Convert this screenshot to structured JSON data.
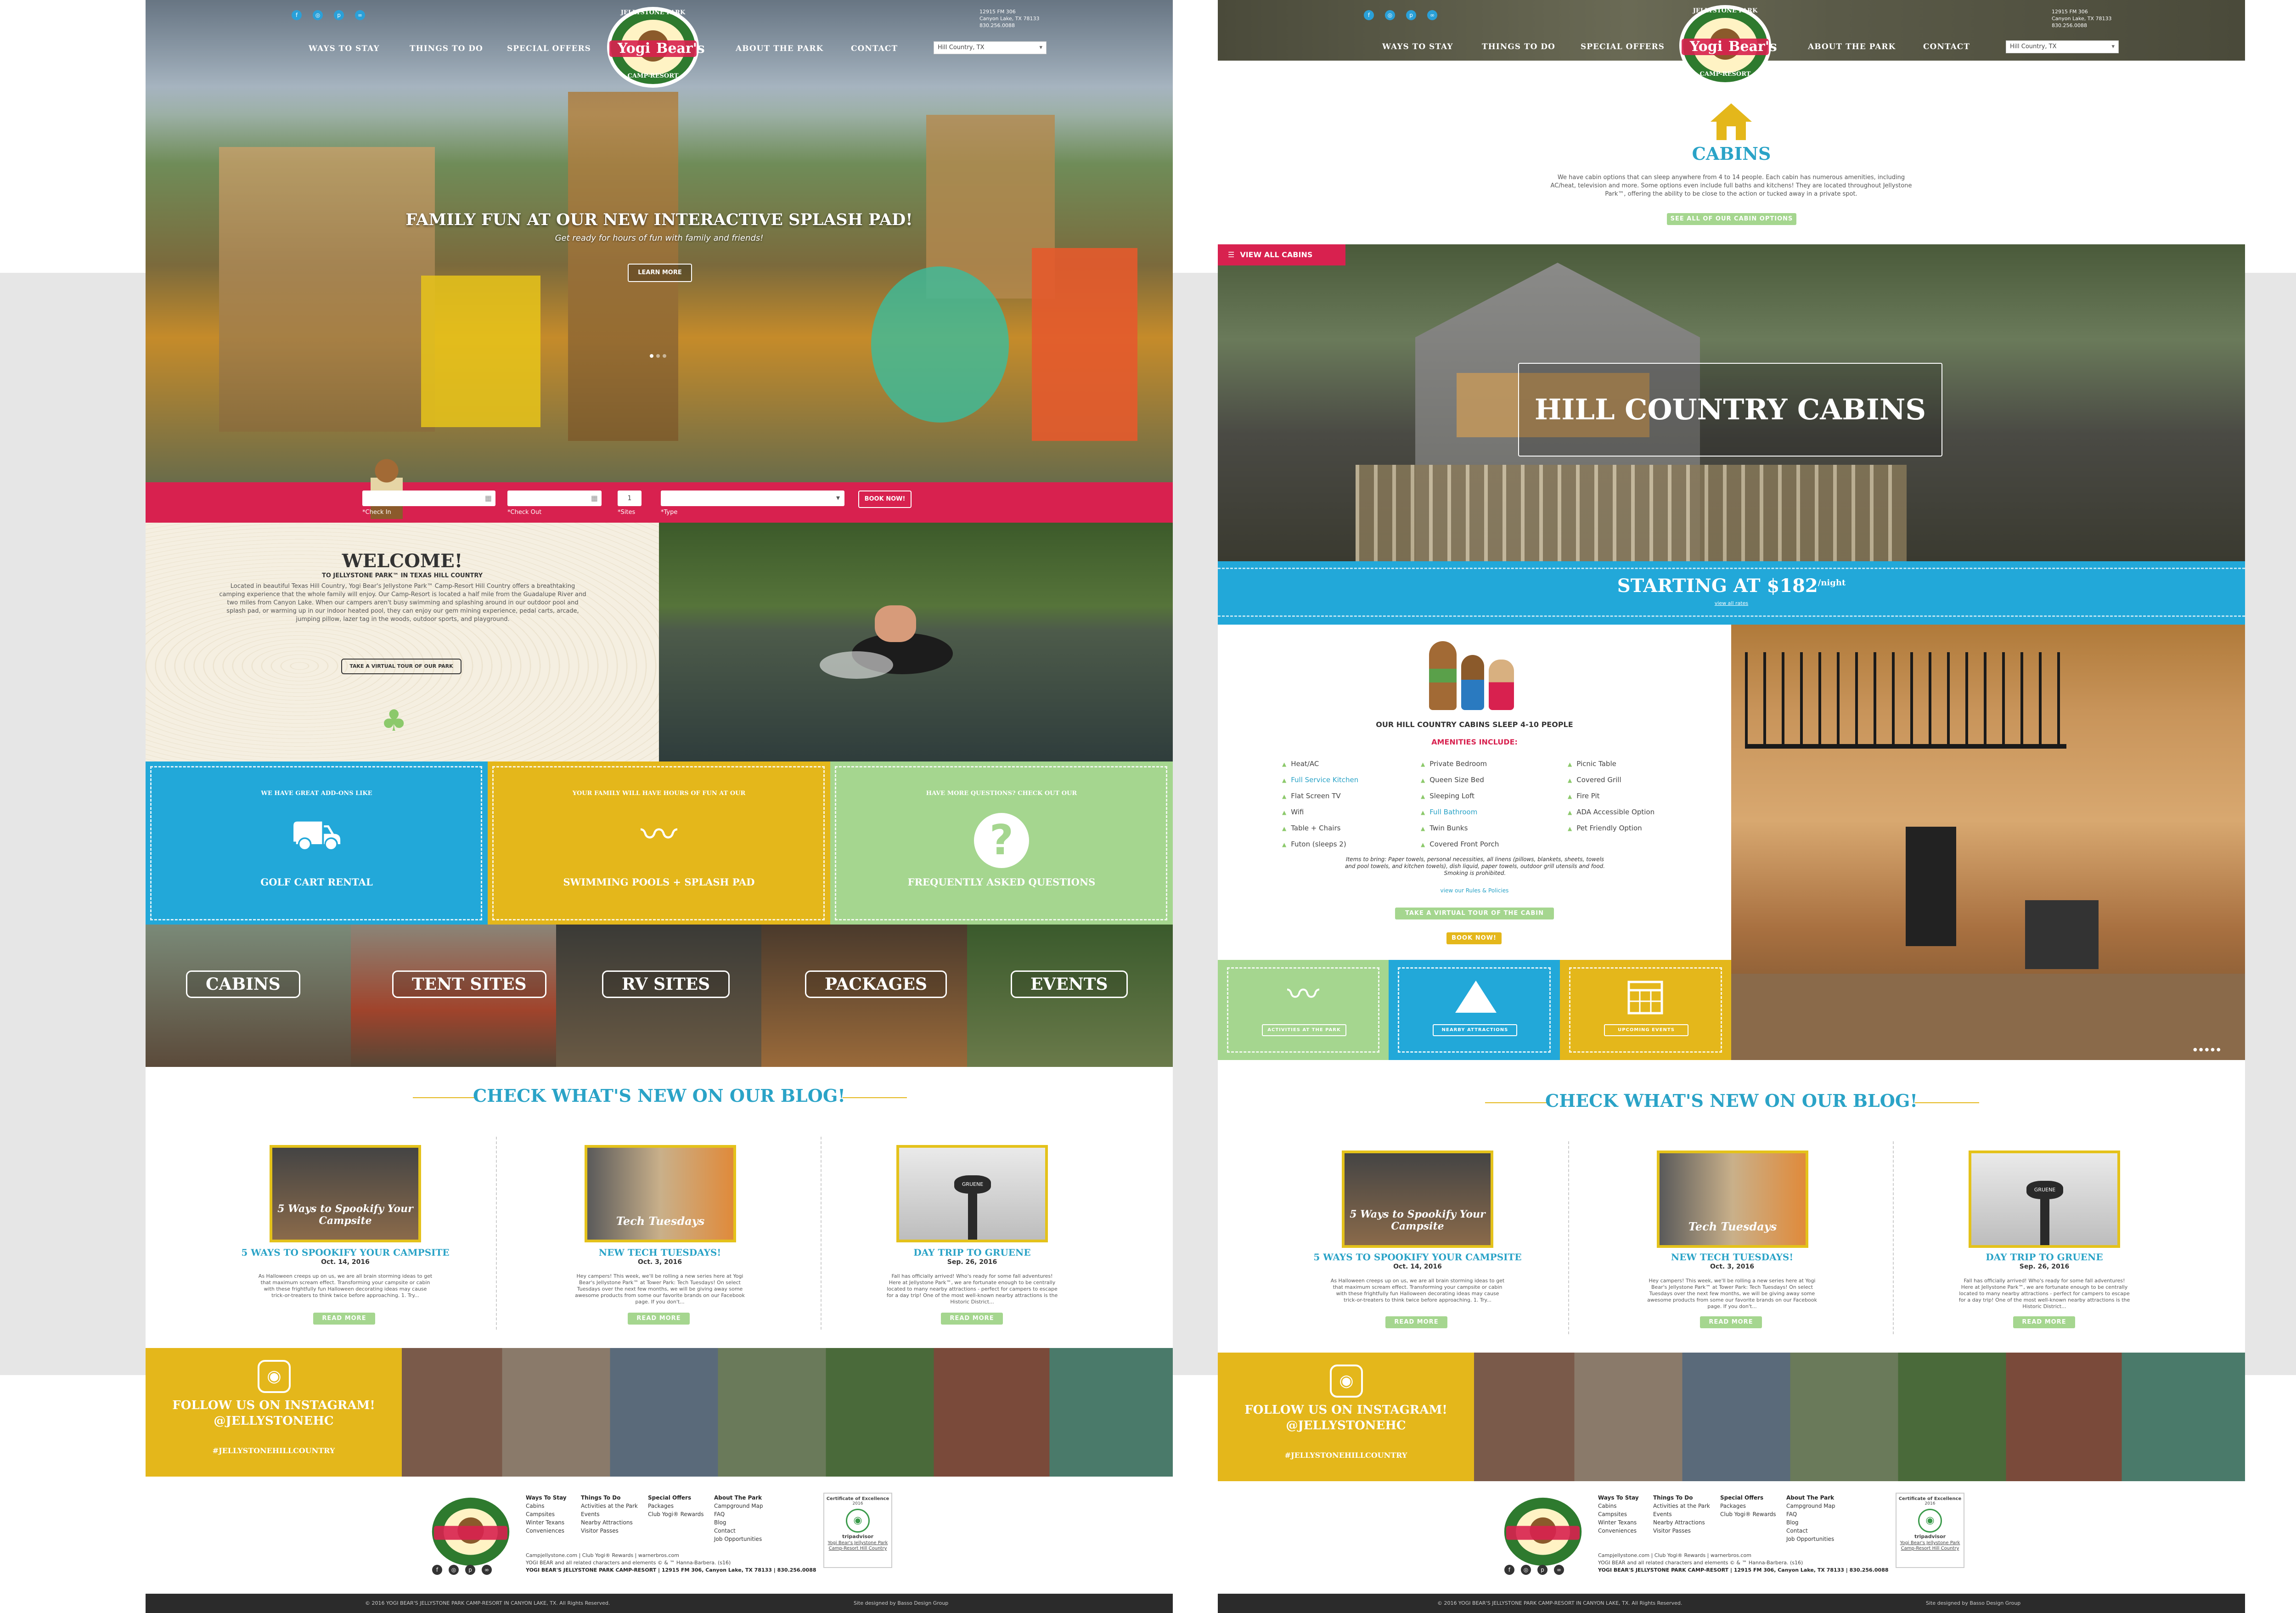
{
  "colors": {
    "blue": "#2aa3c7",
    "red": "#d8214f",
    "yellow": "#e4b71b",
    "green": "#a5d68f",
    "dark": "#2b2b2b"
  },
  "common": {
    "nav": [
      "WAYS TO STAY",
      "THINGS TO DO",
      "SPECIAL OFFERS",
      "ABOUT THE PARK",
      "CONTACT"
    ],
    "address": [
      "12915 FM 306",
      "Canyon Lake, TX 78133",
      "830.256.0088"
    ],
    "location_select": "Hill Country, TX",
    "logo": {
      "top": "JELLYSTONE PARK",
      "name1": "Yogi",
      "name2": "Bear's",
      "bottom": "CAMP-RESORT"
    },
    "blog_title": "CHECK WHAT'S NEW ON OUR BLOG!",
    "posts": [
      {
        "thumb": "5 Ways to Spookify Your Campsite",
        "title": "5 WAYS TO SPOOKIFY YOUR CAMPSITE",
        "date": "Oct. 14, 2016",
        "excerpt": "As Halloween creeps up on us, we are all brain storming ideas to get that maximum scream effect. Transforming your campsite or cabin with these frightfully fun Halloween decorating ideas may cause trick-or-treaters to think twice before approaching. 1. Try...",
        "btn": "READ MORE"
      },
      {
        "thumb": "Tech Tuesdays",
        "title": "NEW TECH TUESDAYS!",
        "date": "Oct. 3, 2016",
        "excerpt": "Hey campers! This week, we'll be rolling a new series here at Yogi Bear's Jellystone Park™ at Tower Park: Tech Tuesdays! On select Tuesdays over the next few months, we will be giving away some awesome products from some our favorite brands on our Facebook page. If you don't...",
        "btn": "READ MORE"
      },
      {
        "thumb": "GRUENE",
        "title": "DAY TRIP TO GRUENE",
        "date": "Sep. 26, 2016",
        "excerpt": "Fall has officially arrived! Who's ready for some fall adventures! Here at Jellystone Park™, we are fortunate enough to be centrally located to many nearby attractions - perfect for campers to escape for a day trip! One of the most well-known nearby attractions is the Historic District...",
        "btn": "READ MORE"
      }
    ],
    "instagram": {
      "line1": "FOLLOW US ON INSTAGRAM!",
      "line2": "@JELLYSTONEHC",
      "tag": "#JELLYSTONEHILLCOUNTRY"
    },
    "footer_cols": [
      {
        "h": "Ways To Stay",
        "items": [
          "Cabins",
          "Campsites",
          "Winter Texans",
          "Conveniences"
        ]
      },
      {
        "h": "Things To Do",
        "items": [
          "Activities at the Park",
          "Events",
          "Nearby Attractions",
          "Visitor Passes"
        ]
      },
      {
        "h": "Special Offers",
        "items": [
          "Packages",
          "Club Yogi® Rewards"
        ]
      },
      {
        "h": "About The Park",
        "items": [
          "Campground Map",
          "FAQ",
          "Blog",
          "Contact",
          "Job Opportunities"
        ]
      }
    ],
    "footer_links": "Campjellystone.com  |  Club Yogi® Rewards  |  warnerbros.com",
    "footer_legal": "YOGI BEAR and all related characters and elements © & ™ Hanna-Barbera. (s16)",
    "footer_addr": "YOGI BEAR'S JELLYSTONE PARK CAMP-RESORT  |  12915 FM 306, Canyon Lake, TX 78133  |  830.256.0088",
    "tripadvisor": {
      "title": "Certificate of Excellence",
      "year": "2016",
      "brand": "tripadvisor",
      "caption": "Yogi Bear's Jellystone Park Camp-Resort Hill Country"
    },
    "copyright": "© 2016 YOGI BEAR'S JELLYSTONE PARK CAMP-RESORT IN CANYON LAKE, TX. All Rights Reserved.",
    "designed": "Site designed by Basso Design Group"
  },
  "left": {
    "hero": {
      "title": "FAMILY FUN AT OUR NEW INTERACTIVE SPLASH PAD!",
      "sub": "Get ready for hours of fun with family and friends!",
      "btn": "LEARN MORE"
    },
    "booking": {
      "checkin": "*Check In",
      "checkout": "*Check Out",
      "sites": "*Sites",
      "sites_val": "1",
      "type": "*Type",
      "btn": "BOOK NOW!"
    },
    "welcome": {
      "title": "WELCOME!",
      "sub": "TO JELLYSTONE PARK™ IN TEXAS HILL COUNTRY",
      "body": "Located in beautiful Texas Hill Country, Yogi Bear's Jellystone Park™ Camp-Resort Hill Country offers a breathtaking camping experience that the whole family will enjoy. Our Camp-Resort is located a half mile from the Guadalupe River and two miles from Canyon Lake. When our campers aren't busy swimming and splashing around in our outdoor pool and splash pad, or warming up in our indoor heated pool, they can enjoy our gem mining experience, pedal carts, arcade, jumping pillow, lazer tag in the woods, outdoor sports, and playground.",
      "btn": "TAKE A VIRTUAL TOUR OF OUR PARK"
    },
    "tiles": [
      {
        "top": "WE HAVE GREAT ADD-ONS LIKE",
        "label": "GOLF CART RENTAL"
      },
      {
        "top": "YOUR FAMILY WILL HAVE HOURS OF FUN AT OUR",
        "label": "SWIMMING POOLS + SPLASH PAD"
      },
      {
        "top": "HAVE MORE QUESTIONS? CHECK OUT OUR",
        "label": "FREQUENTLY ASKED QUESTIONS"
      }
    ],
    "categories": [
      "CABINS",
      "TENT SITES",
      "RV SITES",
      "PACKAGES",
      "EVENTS"
    ]
  },
  "right": {
    "section_title": "CABINS",
    "intro": "We have cabin options that can sleep anywhere from 4 to 14 people. Each cabin has numerous amenities, including AC/heat, television and more. Some options even include full baths and kitchens! They are located throughout Jellystone Park™, offering the ability to be close to the action or tucked away in a private spot.",
    "see_all": "SEE ALL OF OUR CABIN OPTIONS",
    "view_all": "VIEW ALL CABINS",
    "hero_title": "HILL COUNTRY CABINS",
    "price_label": "STARTING AT $182",
    "price_unit": "/night",
    "view_rates": "view all rates",
    "sleeps": "OUR HILL COUNTRY CABINS SLEEP 4-10 PEOPLE",
    "amen_h": "AMENITIES INCLUDE:",
    "amen_col1": [
      "Heat/AC",
      "Full Service Kitchen",
      "Flat Screen TV",
      "Wifi",
      "Table + Chairs",
      "Futon (sleeps 2)"
    ],
    "amen_col2": [
      "Private Bedroom",
      "Queen Size Bed",
      "Sleeping Loft",
      "Full Bathroom",
      "Twin Bunks",
      "Covered Front Porch"
    ],
    "amen_col3": [
      "Picnic Table",
      "Covered Grill",
      "Fire Pit",
      "ADA Accessible Option",
      "Pet Friendly Option"
    ],
    "bring": "Items to bring: Paper towels, personal necessities, all linens (pillows, blankets, sheets, towels and pool towels, and kitchen towels), dish liquid, paper towels, outdoor grill utensils and food. Smoking is prohibited.",
    "rules": "view our Rules & Policies",
    "tour_btn": "TAKE A VIRTUAL TOUR OF THE CABIN",
    "book_btn": "BOOK NOW!",
    "tiles": [
      "ACTIVITIES AT THE PARK",
      "NEARBY ATTRACTIONS",
      "UPCOMING EVENTS"
    ]
  }
}
